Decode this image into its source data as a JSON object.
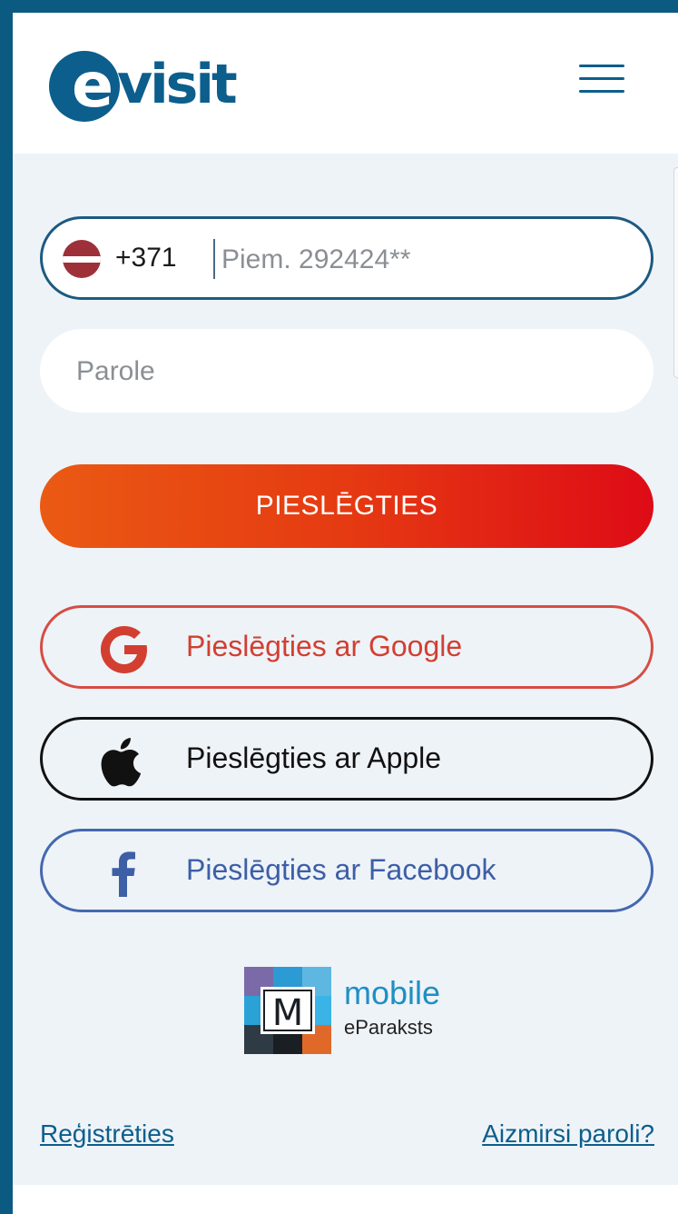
{
  "header": {
    "logo_letter": "e",
    "logo_text": "visit",
    "menu_icon": "hamburger-menu-icon"
  },
  "phone": {
    "country_flag": "latvia-flag",
    "country_code": "+371",
    "placeholder": "Piem. 292424**",
    "value": ""
  },
  "password": {
    "placeholder": "Parole",
    "value": ""
  },
  "login_button": {
    "label": "PIESLĒGTIES",
    "gradient_start": "#ea5a13",
    "gradient_end": "#de0b16"
  },
  "social": {
    "google": {
      "label": "Pieslēgties ar Google",
      "color": "#d23f31",
      "icon": "google-icon"
    },
    "apple": {
      "label": "Pieslēgties ar Apple",
      "color": "#111111",
      "icon": "apple-icon"
    },
    "facebook": {
      "label": "Pieslēgties ar Facebook",
      "color": "#3d5fa6",
      "icon": "facebook-icon"
    }
  },
  "mobile_eparaksts": {
    "title": "mobile",
    "subtitle": "eParaksts",
    "logo_letter": "M"
  },
  "links": {
    "register": "Reģistrēties",
    "forgot": "Aizmirsi paroli?"
  },
  "colors": {
    "brand": "#0c5e8c",
    "background": "#eef3f8"
  }
}
